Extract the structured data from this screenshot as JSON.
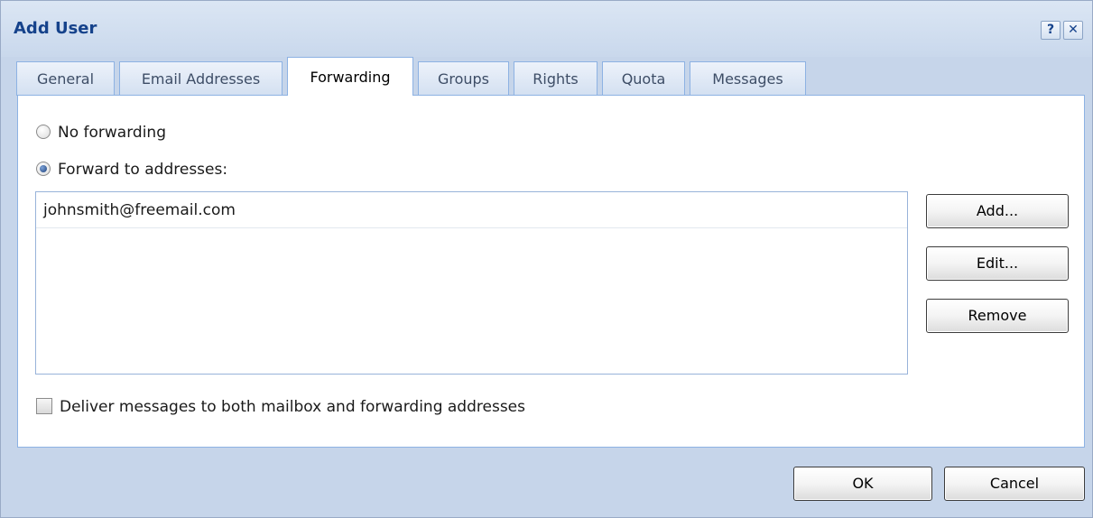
{
  "window": {
    "title": "Add User",
    "help_icon": "?",
    "close_icon": "✕"
  },
  "tabs": [
    {
      "label": "General",
      "active": false
    },
    {
      "label": "Email Addresses",
      "active": false
    },
    {
      "label": "Forwarding",
      "active": true
    },
    {
      "label": "Groups",
      "active": false
    },
    {
      "label": "Rights",
      "active": false
    },
    {
      "label": "Quota",
      "active": false
    },
    {
      "label": "Messages",
      "active": false
    }
  ],
  "forwarding": {
    "no_forwarding_label": "No forwarding",
    "no_forwarding_checked": false,
    "forward_to_label": "Forward to addresses:",
    "forward_to_checked": true,
    "addresses": [
      "johnsmith@freemail.com"
    ],
    "add_label": "Add...",
    "edit_label": "Edit...",
    "remove_label": "Remove",
    "deliver_both_label": "Deliver messages to both mailbox and forwarding addresses",
    "deliver_both_checked": false
  },
  "footer": {
    "ok_label": "OK",
    "cancel_label": "Cancel"
  }
}
